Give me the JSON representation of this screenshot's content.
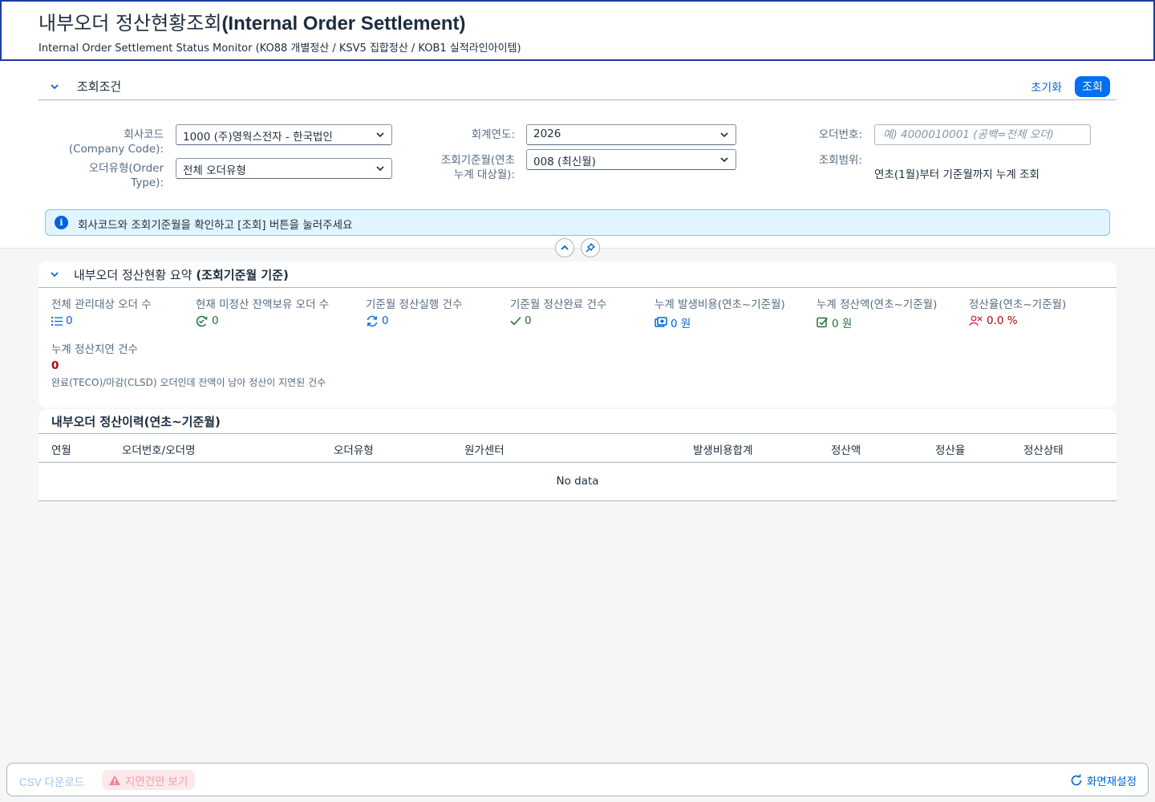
{
  "header": {
    "title_ko": "내부오더 정산현황조회",
    "title_en": "(Internal Order Settlement)",
    "subtitle": "Internal Order Settlement Status Monitor (KO88 개별정산 / KSV5 집합정산 / KOB1 실적라인아이템)"
  },
  "filter": {
    "section_label": "조회조건",
    "reset_label": "초기화",
    "search_label": "조회",
    "company_code_label": "회사코드\n(Company Code):",
    "company_code_value": "1000 (주)영웍스전자 - 한국법인",
    "order_type_label": "오더유형(Order\nType):",
    "order_type_value": "전체 오더유형",
    "fiscal_year_label": "회계연도:",
    "fiscal_year_value": "2026",
    "period_label": "조회기준월(연초\n누계 대상월):",
    "period_value": "008 (최신월)",
    "order_no_label": "오더번호:",
    "order_no_placeholder": "예) 4000010001 (공백=전체 오더)",
    "range_label": "조회범위:",
    "range_value": "연초(1월)부터 기준월까지 누계 조회",
    "info_message": "회사코드와 조회기준월을 확인하고 [조회] 버튼을 눌러주세요"
  },
  "summary": {
    "section_label_a": "내부오더 정산현황 요약 ",
    "section_label_b": "(조회기준월 기준)",
    "kpis": [
      {
        "label": "전체 관리대상 오더 수",
        "value": "0",
        "icon": "list-icon"
      },
      {
        "label": "현재 미정산 잔액보유 오더 수",
        "value": "0",
        "icon": "pending-icon"
      },
      {
        "label": "기준월 정산실행 건수",
        "value": "0",
        "icon": "refresh-icon"
      },
      {
        "label": "기준월 정산완료 건수",
        "value": "0",
        "icon": "check-icon"
      },
      {
        "label": "누계 발생비용(연초~기준월)",
        "value": "0 원",
        "icon": "money-icon"
      },
      {
        "label": "누계 정산액(연초~기준월)",
        "value": "0 원",
        "icon": "checkbox-icon"
      },
      {
        "label": "정산율(연초~기준월)",
        "value": "0.0 %",
        "icon": "people-icon"
      }
    ],
    "delay_label": "누계 정산지연 건수",
    "delay_value": "0",
    "delay_note": "완료(TECO)/마감(CLSD) 오더인데 잔액이 남아 정산이 지연된 건수",
    "colors": {
      "accent": "#0064d9",
      "positive": "#256f3a",
      "negative": "#aa0808"
    }
  },
  "history": {
    "title": "내부오더 정산이력(연초~기준월)",
    "columns": [
      "연월",
      "오더번호/오더명",
      "오더유형",
      "원가센터",
      "발생비용합계",
      "정산액",
      "정산율",
      "정산상태"
    ],
    "empty_text": "No data"
  },
  "footer": {
    "csv_label": "CSV 다운로드",
    "delay_only_label": "지연건만 보기",
    "reset_view_label": "화면재설정"
  }
}
